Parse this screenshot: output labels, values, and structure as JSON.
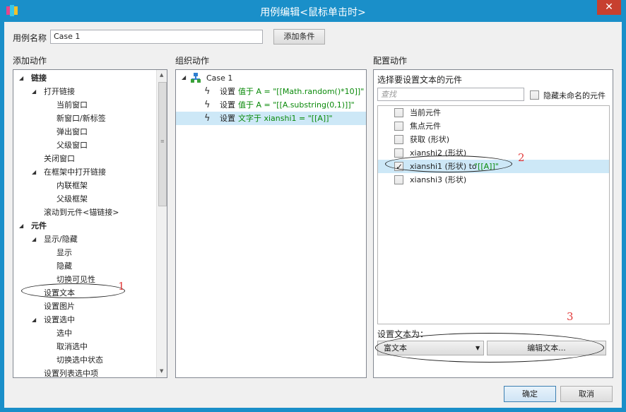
{
  "window": {
    "title": "用例编辑<鼠标单击时>",
    "close_label": "✕"
  },
  "case_name": {
    "label": "用例名称",
    "value": "Case 1",
    "add_condition_label": "添加条件"
  },
  "headers": {
    "add_actions": "添加动作",
    "organize_actions": "组织动作",
    "configure_actions": "配置动作"
  },
  "add_actions_tree": [
    {
      "label": "链接",
      "bold": true,
      "indent": 0,
      "expander": true
    },
    {
      "label": "打开链接",
      "indent": 1,
      "expander": true
    },
    {
      "label": "当前窗口",
      "indent": 2
    },
    {
      "label": "新窗口/新标签",
      "indent": 2
    },
    {
      "label": "弹出窗口",
      "indent": 2
    },
    {
      "label": "父级窗口",
      "indent": 2
    },
    {
      "label": "关闭窗口",
      "indent": 1
    },
    {
      "label": "在框架中打开链接",
      "indent": 1,
      "expander": true
    },
    {
      "label": "内联框架",
      "indent": 2
    },
    {
      "label": "父级框架",
      "indent": 2
    },
    {
      "label": "滚动到元件<锚链接>",
      "indent": 1
    },
    {
      "label": "元件",
      "bold": true,
      "indent": 0,
      "expander": true
    },
    {
      "label": "显示/隐藏",
      "indent": 1,
      "expander": true
    },
    {
      "label": "显示",
      "indent": 2
    },
    {
      "label": "隐藏",
      "indent": 2
    },
    {
      "label": "切换可见性",
      "indent": 2
    },
    {
      "label": "设置文本",
      "indent": 1
    },
    {
      "label": "设置图片",
      "indent": 1
    },
    {
      "label": "设置选中",
      "indent": 1,
      "expander": true
    },
    {
      "label": "选中",
      "indent": 2
    },
    {
      "label": "取消选中",
      "indent": 2
    },
    {
      "label": "切换选中状态",
      "indent": 2
    },
    {
      "label": "设置列表选中项",
      "indent": 1
    }
  ],
  "organize_tree": {
    "case_label": "Case 1",
    "actions": [
      {
        "prefix": "设置",
        "detail": "值于 A = \"[[Math.random()*10]]\"",
        "selected": false
      },
      {
        "prefix": "设置",
        "detail": "值于 A = \"[[A.substring(0,1)]]\"",
        "selected": false
      },
      {
        "prefix": "设置",
        "detail": "文字于 xianshi1 = \"[[A]]\"",
        "selected": true
      }
    ]
  },
  "configure": {
    "widget_select_label": "选择要设置文本的元件",
    "search_placeholder": "查找",
    "hide_unnamed_label": "隐藏未命名的元件",
    "widgets": [
      {
        "label": "当前元件",
        "checked": false,
        "selected": false
      },
      {
        "label": "焦点元件",
        "checked": false,
        "selected": false
      },
      {
        "label": "获取 (形状)",
        "checked": false,
        "selected": false
      },
      {
        "label": "xianshi2 (形状)",
        "checked": false,
        "selected": false
      },
      {
        "label": "xianshi1 (形状) to ",
        "value": "\"[[A]]\"",
        "checked": true,
        "selected": true
      },
      {
        "label": "xianshi3 (形状)",
        "checked": false,
        "selected": false
      }
    ],
    "set_text_label": "设置文本为：",
    "text_type_value": "富文本",
    "edit_text_button": "编辑文本..."
  },
  "footer": {
    "ok_label": "确定",
    "cancel_label": "取消"
  },
  "annotations": {
    "n1": "1",
    "n2": "2",
    "n3": "3"
  },
  "colors": {
    "titlebar": "#1a8fc9",
    "close": "#c7402f",
    "green_text": "#0a8a0a",
    "selection": "#cde8f7",
    "annotation": "#e23a3a"
  }
}
